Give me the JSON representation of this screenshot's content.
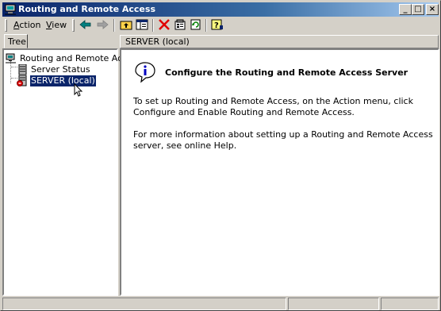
{
  "window": {
    "title": "Routing and Remote Access",
    "minimize": "_",
    "maximize": "□",
    "close": "×"
  },
  "menu": {
    "action": {
      "accel": "A",
      "rest": "ction"
    },
    "view": {
      "accel": "V",
      "rest": "iew"
    }
  },
  "toolbar": {
    "icons": [
      "back-arrow-icon",
      "forward-arrow-icon",
      "up-one-level-icon",
      "show-hide-tree-icon",
      "delete-icon",
      "properties-icon",
      "refresh-icon",
      "help-icon"
    ]
  },
  "tree": {
    "tab_label": "Tree",
    "nodes": [
      {
        "label": "Routing and Remote Access",
        "icon": "computer-network-icon"
      },
      {
        "label": "Server Status",
        "icon": "server-status-icon"
      },
      {
        "label": "SERVER (local)",
        "icon": "server-stopped-icon",
        "selected": true
      }
    ]
  },
  "result": {
    "header": "SERVER (local)",
    "heading": "Configure the Routing and Remote Access Server",
    "para1": "To set up Routing and Remote Access, on the Action menu, click Configure and Enable Routing and Remote Access.",
    "para2": "For more information about setting up a Routing and Remote Access server, see online Help."
  },
  "colors": {
    "titlebar_start": "#0a246a",
    "titlebar_end": "#a6caf0",
    "selection": "#0a246a",
    "face": "#d4d0c8"
  }
}
